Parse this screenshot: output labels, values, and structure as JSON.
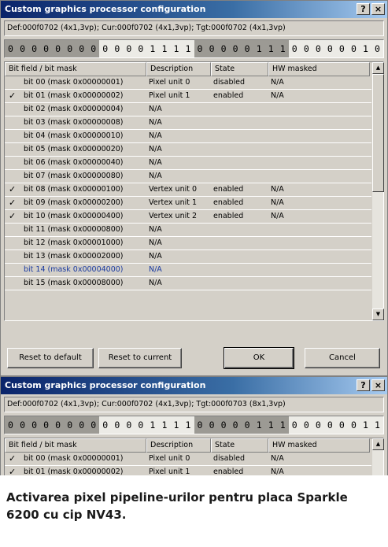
{
  "dialog1": {
    "title": "Custom graphics processor configuration",
    "help_label": "?",
    "close_label": "×",
    "info": "Def:000f0702 (4x1,3vp); Cur:000f0702 (4x1,3vp); Tgt:000f0702 (4x1,3vp)",
    "bits": [
      "0",
      "0",
      "0",
      "0",
      "0",
      "0",
      "0",
      "0",
      "0",
      "0",
      "0",
      "0",
      "1",
      "1",
      "1",
      "1",
      "0",
      "0",
      "0",
      "0",
      "0",
      "1",
      "1",
      "1",
      "0",
      "0",
      "0",
      "0",
      "0",
      "0",
      "1",
      "0"
    ],
    "columns": [
      "Bit field / bit mask",
      "Description",
      "State",
      "HW masked"
    ],
    "rows": [
      {
        "check": "",
        "field": "bit 00 (mask 0x00000001)",
        "desc": "Pixel unit 0",
        "state": "disabled",
        "hw": "N/A"
      },
      {
        "check": "✓",
        "field": "bit 01 (mask 0x00000002)",
        "desc": "Pixel unit 1",
        "state": "enabled",
        "hw": "N/A"
      },
      {
        "check": "",
        "field": "bit 02 (mask 0x00000004)",
        "desc": "N/A",
        "state": "",
        "hw": ""
      },
      {
        "check": "",
        "field": "bit 03 (mask 0x00000008)",
        "desc": "N/A",
        "state": "",
        "hw": ""
      },
      {
        "check": "",
        "field": "bit 04 (mask 0x00000010)",
        "desc": "N/A",
        "state": "",
        "hw": ""
      },
      {
        "check": "",
        "field": "bit 05 (mask 0x00000020)",
        "desc": "N/A",
        "state": "",
        "hw": ""
      },
      {
        "check": "",
        "field": "bit 06 (mask 0x00000040)",
        "desc": "N/A",
        "state": "",
        "hw": ""
      },
      {
        "check": "",
        "field": "bit 07 (mask 0x00000080)",
        "desc": "N/A",
        "state": "",
        "hw": ""
      },
      {
        "check": "✓",
        "field": "bit 08 (mask 0x00000100)",
        "desc": "Vertex unit 0",
        "state": "enabled",
        "hw": "N/A"
      },
      {
        "check": "✓",
        "field": "bit 09 (mask 0x00000200)",
        "desc": "Vertex unit 1",
        "state": "enabled",
        "hw": "N/A"
      },
      {
        "check": "✓",
        "field": "bit 10 (mask 0x00000400)",
        "desc": "Vertex unit 2",
        "state": "enabled",
        "hw": "N/A"
      },
      {
        "check": "",
        "field": "bit 11 (mask 0x00000800)",
        "desc": "N/A",
        "state": "",
        "hw": ""
      },
      {
        "check": "",
        "field": "bit 12 (mask 0x00001000)",
        "desc": "N/A",
        "state": "",
        "hw": ""
      },
      {
        "check": "",
        "field": "bit 13 (mask 0x00002000)",
        "desc": "N/A",
        "state": "",
        "hw": ""
      },
      {
        "check": "",
        "field": "bit 14 (mask 0x00004000)",
        "desc": "N/A",
        "state": "",
        "hw": ""
      },
      {
        "check": "",
        "field": "bit 15 (mask 0x00008000)",
        "desc": "N/A",
        "state": "",
        "hw": ""
      }
    ],
    "buttons": {
      "reset_default": "Reset to default",
      "reset_current": "Reset to current",
      "ok": "OK",
      "cancel": "Cancel"
    }
  },
  "dialog2": {
    "title": "Custom graphics processor configuration",
    "help_label": "?",
    "close_label": "×",
    "info": "Def:000f0702 (4x1,3vp); Cur:000f0702 (4x1,3vp); Tgt:000f0703 (8x1,3vp)",
    "bits": [
      "0",
      "0",
      "0",
      "0",
      "0",
      "0",
      "0",
      "0",
      "0",
      "0",
      "0",
      "0",
      "1",
      "1",
      "1",
      "1",
      "0",
      "0",
      "0",
      "0",
      "0",
      "1",
      "1",
      "1",
      "0",
      "0",
      "0",
      "0",
      "0",
      "0",
      "1",
      "1"
    ],
    "columns": [
      "Bit field / bit mask",
      "Description",
      "State",
      "HW masked"
    ],
    "rows": [
      {
        "check": "✓",
        "field": "bit 00 (mask 0x00000001)",
        "desc": "Pixel unit 0",
        "state": "disabled",
        "hw": "N/A"
      },
      {
        "check": "✓",
        "field": "bit 01 (mask 0x00000002)",
        "desc": "Pixel unit 1",
        "state": "enabled",
        "hw": "N/A"
      }
    ]
  },
  "caption": "Activarea pixel pipeline-urilor pentru placa Sparkle 6200 cu cip NV43."
}
